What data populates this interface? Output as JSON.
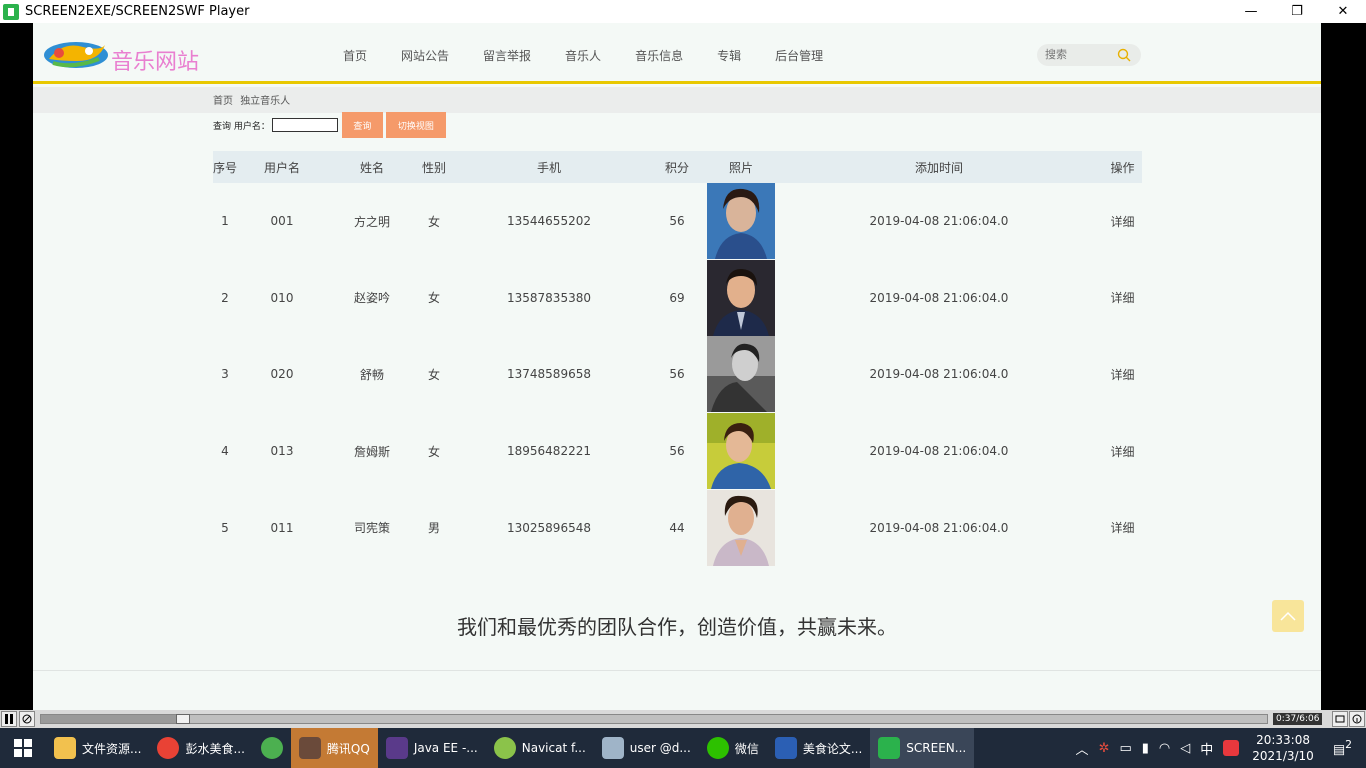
{
  "window": {
    "title": "SCREEN2EXE/SCREEN2SWF Player",
    "minimize": "—",
    "maximize": "❐",
    "close": "✕"
  },
  "site": {
    "logo_text": "音乐网站",
    "nav": [
      "首页",
      "网站公告",
      "留言举报",
      "音乐人",
      "音乐信息",
      "专辑",
      "后台管理"
    ],
    "search_placeholder": "搜索"
  },
  "breadcrumb": [
    "首页",
    "独立音乐人"
  ],
  "query": {
    "label": "查询 用户名：",
    "search_button": "查询",
    "switch_button": "切换视图"
  },
  "table": {
    "headers": [
      "序号",
      "用户名",
      "姓名",
      "性别",
      "手机",
      "积分",
      "照片",
      "添加时间",
      "操作"
    ],
    "rows": [
      {
        "no": "1",
        "user": "001",
        "name": "方之明",
        "gender": "女",
        "phone": "13544655202",
        "points": "56",
        "time": "2019-04-08 21:06:04.0",
        "action": "详细"
      },
      {
        "no": "2",
        "user": "010",
        "name": "赵姿吟",
        "gender": "女",
        "phone": "13587835380",
        "points": "69",
        "time": "2019-04-08 21:06:04.0",
        "action": "详细"
      },
      {
        "no": "3",
        "user": "020",
        "name": "舒畅",
        "gender": "女",
        "phone": "13748589658",
        "points": "56",
        "time": "2019-04-08 21:06:04.0",
        "action": "详细"
      },
      {
        "no": "4",
        "user": "013",
        "name": "詹姆斯",
        "gender": "女",
        "phone": "18956482221",
        "points": "56",
        "time": "2019-04-08 21:06:04.0",
        "action": "详细"
      },
      {
        "no": "5",
        "user": "011",
        "name": "司宪策",
        "gender": "男",
        "phone": "13025896548",
        "points": "44",
        "time": "2019-04-08 21:06:04.0",
        "action": "详细"
      }
    ]
  },
  "slogan": "我们和最优秀的团队合作，创造价值，共赢未来。",
  "player": {
    "timecode": "0:37/6:06",
    "progress": 0.11
  },
  "taskbar": {
    "tasks": [
      "文件资源...",
      "彭水美食...",
      "",
      "腾讯QQ",
      "Java EE -...",
      "Navicat f...",
      "user @d...",
      "微信",
      "美食论文...",
      "SCREEN..."
    ],
    "ime": "中",
    "time": "20:33:08",
    "date": "2021/3/10",
    "notifications": "2"
  },
  "colors": {
    "accent": "#e8c800",
    "button": "#f59a6a",
    "logo": "#e97fd0"
  }
}
